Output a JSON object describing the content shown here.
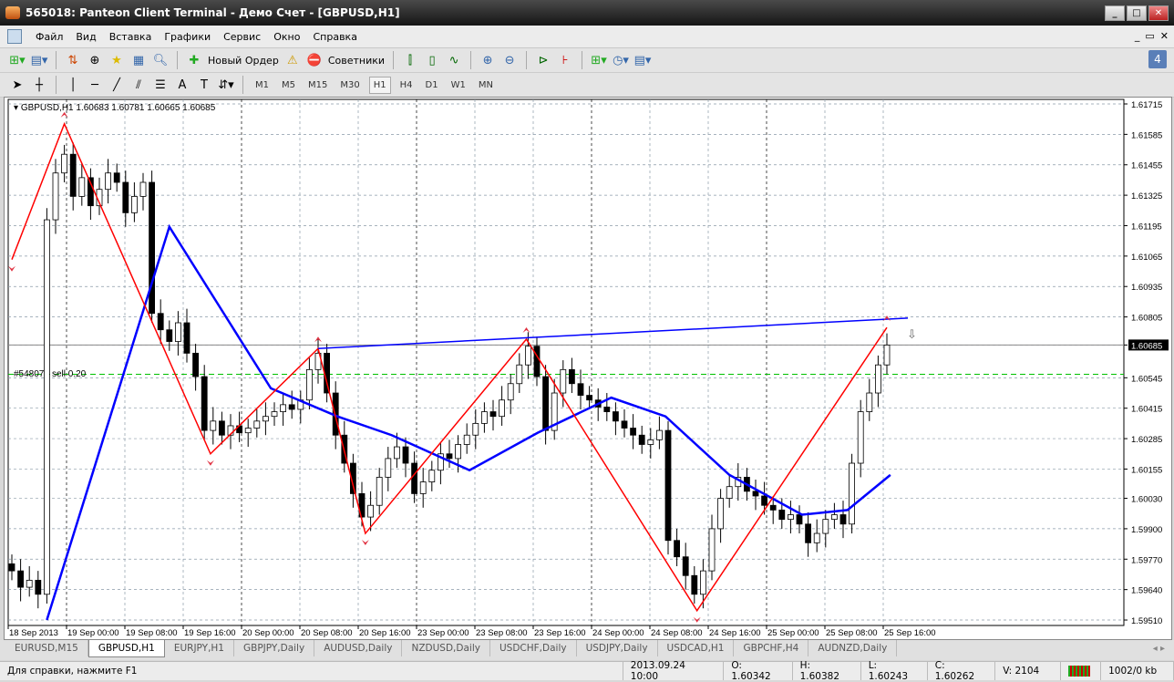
{
  "window": {
    "title": "565018: Panteon Client Terminal - Демо Счет - [GBPUSD,H1]"
  },
  "menu": [
    "Файл",
    "Вид",
    "Вставка",
    "Графики",
    "Сервис",
    "Окно",
    "Справка"
  ],
  "toolbar": {
    "new_order": "Новый Ордер",
    "experts": "Советники",
    "notifications": "4"
  },
  "timeframes": [
    "M1",
    "M5",
    "M15",
    "M30",
    "H1",
    "H4",
    "D1",
    "W1",
    "MN"
  ],
  "active_timeframe": "H1",
  "chart": {
    "header": "GBPUSD,H1  1.60683 1.60781 1.60665 1.60685",
    "order_id": "#54807",
    "order_label": "sell 0.20",
    "order_price": 1.6056,
    "current_price": "1.60685",
    "colors": {
      "bull": "#ffffff",
      "bear": "#000000",
      "zigzag": "#ff0000",
      "ma": "#0000ff",
      "trendline": "#0000ff",
      "order": "#00c000"
    }
  },
  "chart_data": {
    "type": "candlestick",
    "symbol": "GBPUSD",
    "timeframe": "H1",
    "price_ticks": [
      "1.61715",
      "1.61585",
      "1.61455",
      "1.61325",
      "1.61195",
      "1.61065",
      "1.60935",
      "1.60805",
      "1.60685",
      "1.60545",
      "1.60415",
      "1.60285",
      "1.60155",
      "1.60030",
      "1.59900",
      "1.59770",
      "1.59640",
      "1.59510"
    ],
    "time_ticks": [
      "18 Sep 2013",
      "19 Sep 00:00",
      "19 Sep 08:00",
      "19 Sep 16:00",
      "20 Sep 00:00",
      "20 Sep 08:00",
      "20 Sep 16:00",
      "23 Sep 00:00",
      "23 Sep 08:00",
      "23 Sep 16:00",
      "24 Sep 00:00",
      "24 Sep 08:00",
      "24 Sep 16:00",
      "25 Sep 00:00",
      "25 Sep 08:00",
      "25 Sep 16:00"
    ],
    "ylim": [
      1.5951,
      1.61715
    ],
    "first_open": 1.5975,
    "closes": [
      1.5972,
      1.5965,
      1.5968,
      1.5962,
      1.6122,
      1.6142,
      1.615,
      1.6132,
      1.614,
      1.6128,
      1.6135,
      1.6142,
      1.6138,
      1.6125,
      1.6132,
      1.6138,
      1.6082,
      1.6075,
      1.607,
      1.6078,
      1.6065,
      1.6055,
      1.6032,
      1.6036,
      1.603,
      1.6034,
      1.6031,
      1.6033,
      1.6036,
      1.6038,
      1.604,
      1.6043,
      1.6041,
      1.6045,
      1.6058,
      1.6065,
      1.6048,
      1.603,
      1.6018,
      1.6005,
      1.5995,
      1.6,
      1.6012,
      1.602,
      1.6025,
      1.6018,
      1.6005,
      1.601,
      1.6015,
      1.6022,
      1.602,
      1.6026,
      1.603,
      1.6035,
      1.604,
      1.6038,
      1.6045,
      1.6052,
      1.606,
      1.6068,
      1.6055,
      1.6032,
      1.6048,
      1.6058,
      1.6052,
      1.6047,
      1.6045,
      1.6042,
      1.604,
      1.6036,
      1.6033,
      1.603,
      1.6026,
      1.6028,
      1.6032,
      1.5985,
      1.5978,
      1.597,
      1.5962,
      1.5972,
      1.599,
      1.6003,
      1.6008,
      1.6012,
      1.6006,
      1.6004,
      1.6,
      1.5998,
      1.5994,
      1.5996,
      1.5992,
      1.5984,
      1.5988,
      1.5994,
      1.5996,
      1.5992,
      1.6018,
      1.604,
      1.6048,
      1.606,
      1.60685
    ],
    "zigzag": [
      [
        0,
        1.6105
      ],
      [
        6,
        1.6163
      ],
      [
        22.7,
        1.6022
      ],
      [
        35,
        1.6067
      ],
      [
        40.4,
        1.5988
      ],
      [
        58.8,
        1.6071
      ],
      [
        78.3,
        1.5955
      ],
      [
        100,
        1.6076
      ]
    ],
    "moving_average": [
      [
        4,
        1.5951
      ],
      [
        18,
        1.6119
      ],
      [
        29.6,
        1.605
      ],
      [
        37.2,
        1.6038
      ],
      [
        43.4,
        1.603
      ],
      [
        52.3,
        1.6015
      ],
      [
        60.1,
        1.6031
      ],
      [
        68.5,
        1.6046
      ],
      [
        74.7,
        1.6038
      ],
      [
        82,
        1.6013
      ],
      [
        90.3,
        1.5996
      ],
      [
        95.5,
        1.5998
      ],
      [
        100.4,
        1.6013
      ]
    ],
    "trendline": [
      [
        35,
        1.6067
      ],
      [
        102.4,
        1.608
      ]
    ]
  },
  "tabs": [
    "EURUSD,M15",
    "GBPUSD,H1",
    "EURJPY,H1",
    "GBPJPY,Daily",
    "AUDUSD,Daily",
    "NZDUSD,Daily",
    "USDCHF,Daily",
    "USDJPY,Daily",
    "USDCAD,H1",
    "GBPCHF,H4",
    "AUDNZD,Daily"
  ],
  "active_tab": "GBPUSD,H1",
  "status": {
    "help": "Для справки, нажмите F1",
    "datetime": "2013.09.24 10:00",
    "open": "O: 1.60342",
    "high": "H: 1.60382",
    "low": "L: 1.60243",
    "close": "C: 1.60262",
    "volume": "V: 2104",
    "traffic": "1002/0 kb"
  }
}
